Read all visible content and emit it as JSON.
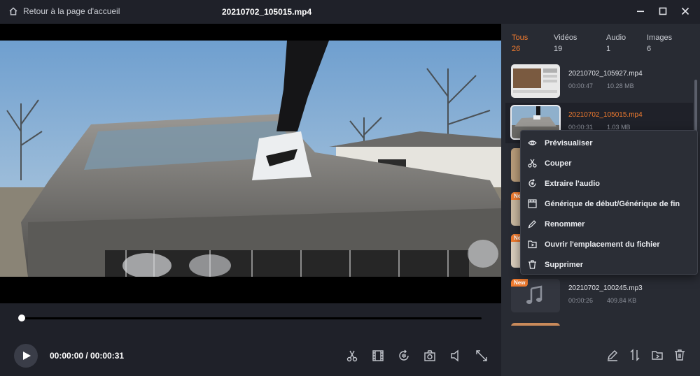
{
  "titlebar": {
    "back_label": "Retour à la page d'accueil",
    "file_title": "20210702_105015.mp4"
  },
  "player": {
    "timecode": "00:00:00 / 00:00:31",
    "progress": 0,
    "tools": [
      "cut-icon",
      "frames-icon",
      "audio-extract-icon",
      "snapshot-icon",
      "volume-icon",
      "fullscreen-icon"
    ]
  },
  "tabs": [
    {
      "label": "Tous",
      "count": "26"
    },
    {
      "label": "Vidéos",
      "count": "19"
    },
    {
      "label": "Audio",
      "count": "1"
    },
    {
      "label": "Images",
      "count": "6"
    }
  ],
  "files": [
    {
      "name": "20210702_105927.mp4",
      "duration": "00:00:47",
      "size": "10.28 MB",
      "badge": ""
    },
    {
      "name": "20210702_105015.mp4",
      "duration": "00:00:31",
      "size": "1.03 MB",
      "badge": ""
    },
    {
      "name": "",
      "duration": "",
      "size": "",
      "badge": ""
    },
    {
      "name": "",
      "duration": "",
      "size": "",
      "badge": "New"
    },
    {
      "name": "",
      "duration": "",
      "size": "",
      "badge": "New"
    },
    {
      "name": "20210702_100245.mp3",
      "duration": "00:00:26",
      "size": "409.84 KB",
      "badge": "New"
    }
  ],
  "context_menu": [
    {
      "label": "Prévisualiser",
      "icon": "eye-icon"
    },
    {
      "label": "Couper",
      "icon": "scissors-icon"
    },
    {
      "label": "Extraire l'audio",
      "icon": "audio-icon"
    },
    {
      "label": "Générique de début/Générique de fin",
      "icon": "credits-icon"
    },
    {
      "label": "Renommer",
      "icon": "pencil-icon"
    },
    {
      "label": "Ouvrir l'emplacement du fichier",
      "icon": "folder-icon"
    },
    {
      "label": "Supprimer",
      "icon": "trash-icon"
    }
  ],
  "colors": {
    "accent": "#f07b2f",
    "background": "#1f2129",
    "panel": "#282b33"
  }
}
